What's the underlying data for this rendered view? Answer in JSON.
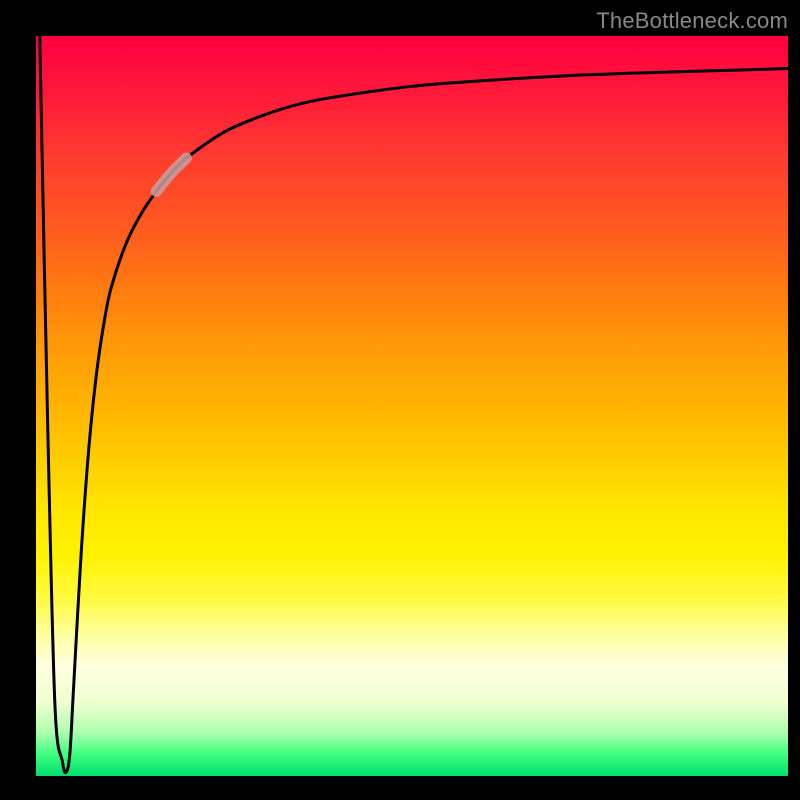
{
  "watermark": "TheBottleneck.com",
  "colors": {
    "page_bg": "#000000",
    "curve": "#000000",
    "highlight": "#c8a0a0",
    "watermark": "#888888"
  },
  "chart_data": {
    "type": "line",
    "title": "",
    "xlabel": "",
    "ylabel": "",
    "xlim": [
      0,
      100
    ],
    "ylim": [
      0,
      100
    ],
    "grid": false,
    "legend": false,
    "series": [
      {
        "name": "curve",
        "x": [
          0.5,
          1.5,
          2.5,
          3.5,
          4.0,
          4.5,
          5,
          6,
          7,
          8,
          9,
          10,
          12,
          14,
          16,
          18,
          20,
          25,
          30,
          35,
          40,
          50,
          60,
          70,
          80,
          90,
          100
        ],
        "values": [
          100,
          50,
          10,
          2,
          0.5,
          3,
          12,
          30,
          44,
          54,
          61,
          66,
          72,
          76,
          79,
          81.5,
          83.5,
          87,
          89.2,
          90.8,
          91.8,
          93.2,
          94.0,
          94.6,
          95.0,
          95.3,
          95.6
        ]
      }
    ],
    "highlight_segment": {
      "series": "curve",
      "x_start": 16,
      "x_end": 22
    }
  }
}
